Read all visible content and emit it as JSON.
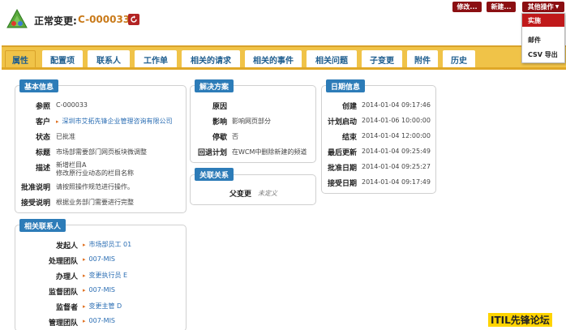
{
  "header": {
    "title_label": "正常变更:",
    "change_id": "C-000033",
    "buttons": {
      "edit": "修改...",
      "new": "新建...",
      "other": "其他操作"
    }
  },
  "dropdown": {
    "items": [
      "实施",
      "邮件",
      "CSV 导出"
    ],
    "selected": "实施"
  },
  "tabs": [
    "属性",
    "配置项",
    "联系人",
    "工作单",
    "相关的请求",
    "相关的事件",
    "相关问题",
    "子变更",
    "附件",
    "历史"
  ],
  "active_tab": "属性",
  "basic_info": {
    "title": "基本信息",
    "rows": [
      {
        "label": "参照",
        "value": "C-000033"
      },
      {
        "label": "客户",
        "value": "深圳市艾拓先锋企业管理咨询有限公司"
      },
      {
        "label": "状态",
        "value": "已批准"
      },
      {
        "label": "标题",
        "value": "市场部需要部门网页板块微调整"
      },
      {
        "label": "描述",
        "value": "新增栏目A",
        "value2": "修改原行业动态的栏目名称"
      },
      {
        "label": "批准说明",
        "value": "请按照操作规范进行操作。"
      },
      {
        "label": "接受说明",
        "value": "根据业务部门需要进行完整"
      }
    ]
  },
  "solution": {
    "title": "解决方案",
    "rows": [
      {
        "label": "原因",
        "value": ""
      },
      {
        "label": "影响",
        "value": "影响网页部分"
      },
      {
        "label": "停歇",
        "value": "否"
      },
      {
        "label": "回退计划",
        "value": "在WCM中删除新建的频道"
      }
    ]
  },
  "relations": {
    "title": "关联关系",
    "rows": [
      {
        "label": "父变更",
        "value": "未定义"
      }
    ]
  },
  "dates": {
    "title": "日期信息",
    "rows": [
      {
        "label": "创建",
        "value": "2014-01-04 09:17:46"
      },
      {
        "label": "计划启动",
        "value": "2014-01-06 10:00:00"
      },
      {
        "label": "结束",
        "value": "2014-01-04 12:00:00"
      },
      {
        "label": "最后更新",
        "value": "2014-01-04 09:25:49"
      },
      {
        "label": "批准日期",
        "value": "2014-01-04 09:25:27"
      },
      {
        "label": "接受日期",
        "value": "2014-01-04 09:17:49"
      }
    ]
  },
  "contacts": {
    "title": "相关联系人",
    "rows": [
      {
        "label": "发起人",
        "value": "市场部员工 01"
      },
      {
        "label": "处理团队",
        "value": "007-MIS"
      },
      {
        "label": "办理人",
        "value": "变更执行员 E"
      },
      {
        "label": "监督团队",
        "value": "007-MIS"
      },
      {
        "label": "监督者",
        "value": "变更主管 D"
      },
      {
        "label": "管理团队",
        "value": "007-MIS"
      }
    ]
  },
  "watermark": "ITIL先锋论坛"
}
